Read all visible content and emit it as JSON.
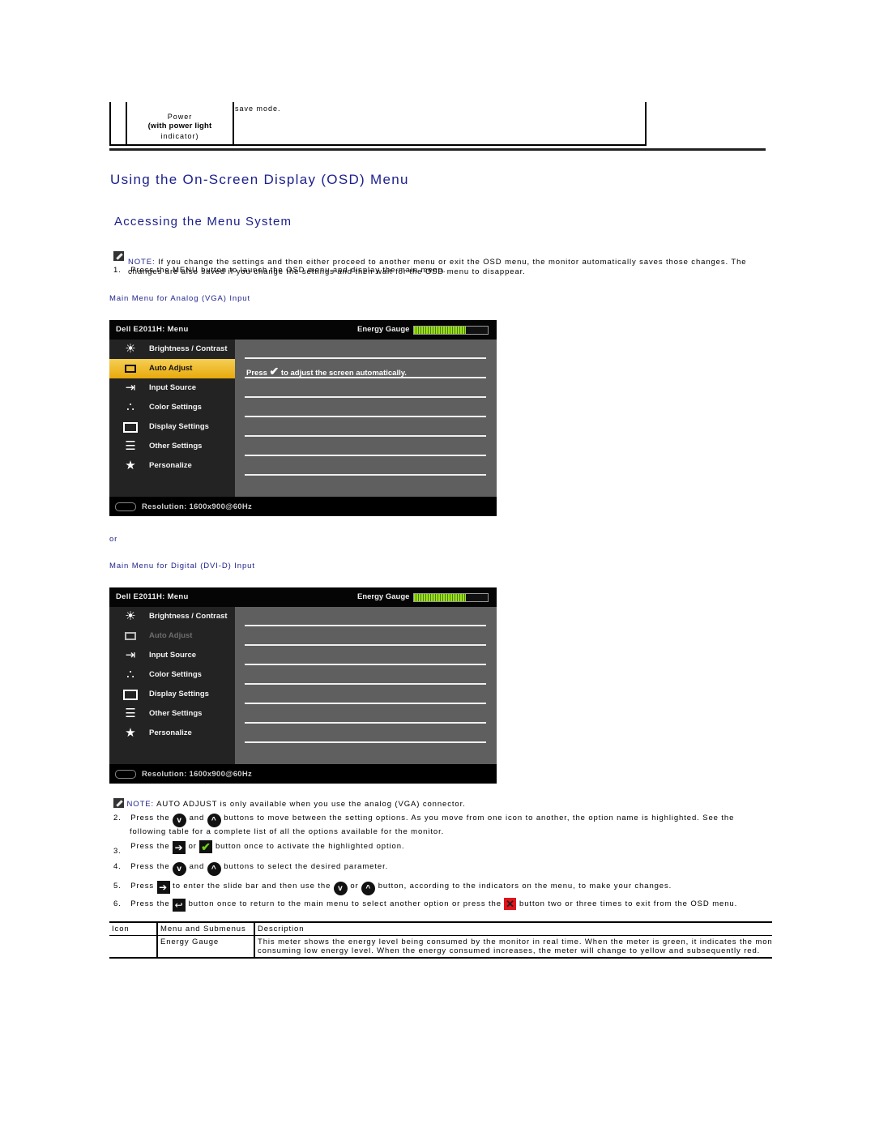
{
  "top_table": {
    "left_cell": {
      "line1": "Power",
      "line2_bold": "(with power light",
      "line3": "indicator)"
    },
    "right_cell": "save mode."
  },
  "section_title": "Using the On-Screen Display (OSD) Menu",
  "subsection_title": "Accessing the Menu System",
  "note1": {
    "label": "NOTE:",
    "text": " If you change the settings and then either proceed to another menu or exit the OSD menu, the monitor automatically saves those changes. The",
    "text2": "changes are also saved if you change the settings and then wait for the OSD menu to disappear."
  },
  "step1": {
    "num": "1.",
    "text": "Press the MENU button to launch the OSD menu and display the main menu."
  },
  "caption_analog": "Main Menu for Analog (VGA) Input",
  "or_text": "or",
  "caption_digital": "Main Menu for Digital (DVI-D) Input",
  "osd": {
    "title": "Dell E2011H:  Menu",
    "energy_label": "Energy Gauge",
    "energy_level_fraction": 0.7,
    "resolution": "Resolution:  1600x900@60Hz",
    "items": [
      {
        "label": "Brightness / Contrast",
        "icon": "brightness-icon"
      },
      {
        "label": "Auto Adjust",
        "icon": "auto-adjust-icon"
      },
      {
        "label": "Input Source",
        "icon": "input-source-icon"
      },
      {
        "label": "Color Settings",
        "icon": "color-settings-icon"
      },
      {
        "label": "Display Settings",
        "icon": "display-settings-icon"
      },
      {
        "label": "Other Settings",
        "icon": "other-settings-icon"
      },
      {
        "label": "Personalize",
        "icon": "star-icon"
      }
    ],
    "analog_selected": "Auto Adjust",
    "analog_message_prefix": "Press",
    "analog_message_suffix": "to adjust the screen automatically.",
    "digital_disabled": "Auto Adjust"
  },
  "note2": {
    "label": "NOTE:",
    "text": " AUTO ADJUST is only available when you use the analog (VGA) connector."
  },
  "steps": {
    "s2": {
      "num": "2.",
      "a": "Press the",
      "b": "and",
      "c": "buttons to move between the setting options. As you move from one icon to another, the option name is highlighted. See the",
      "d": "following table for a complete list of all the options available for the monitor."
    },
    "s3": {
      "num": "3.",
      "a": "Press the",
      "b": "or",
      "c": "button once to activate the highlighted option."
    },
    "s4": {
      "num": "4.",
      "a": "Press the",
      "b": "and",
      "c": "buttons to select the desired parameter."
    },
    "s5": {
      "num": "5.",
      "a": "Press",
      "b": "to enter the slide bar and then use the",
      "c": "or",
      "d": "button, according to the indicators on the menu, to make your changes."
    },
    "s6": {
      "num": "6.",
      "a": "Press the",
      "b": "button once to return to the main menu to select another option or press the",
      "c": "button two or three times to exit from the OSD menu."
    }
  },
  "options_table": {
    "headers": [
      "Icon",
      "Menu and Submenus",
      "Description"
    ],
    "rows": [
      {
        "icon": "",
        "menu": "Energy Gauge",
        "desc1": "This meter shows the energy level being consumed by the monitor in real time. When the meter is green, it indicates the mon",
        "desc2": "consuming low energy level. When the energy consumed increases, the meter will change to yellow and subsequently red."
      }
    ]
  },
  "colors": {
    "heading_blue": "#1b1f8a",
    "selected_gold": "#e9a90c",
    "gauge_green": "#9be21a",
    "exit_red": "#e0141a",
    "check_green": "#6fd11c"
  }
}
